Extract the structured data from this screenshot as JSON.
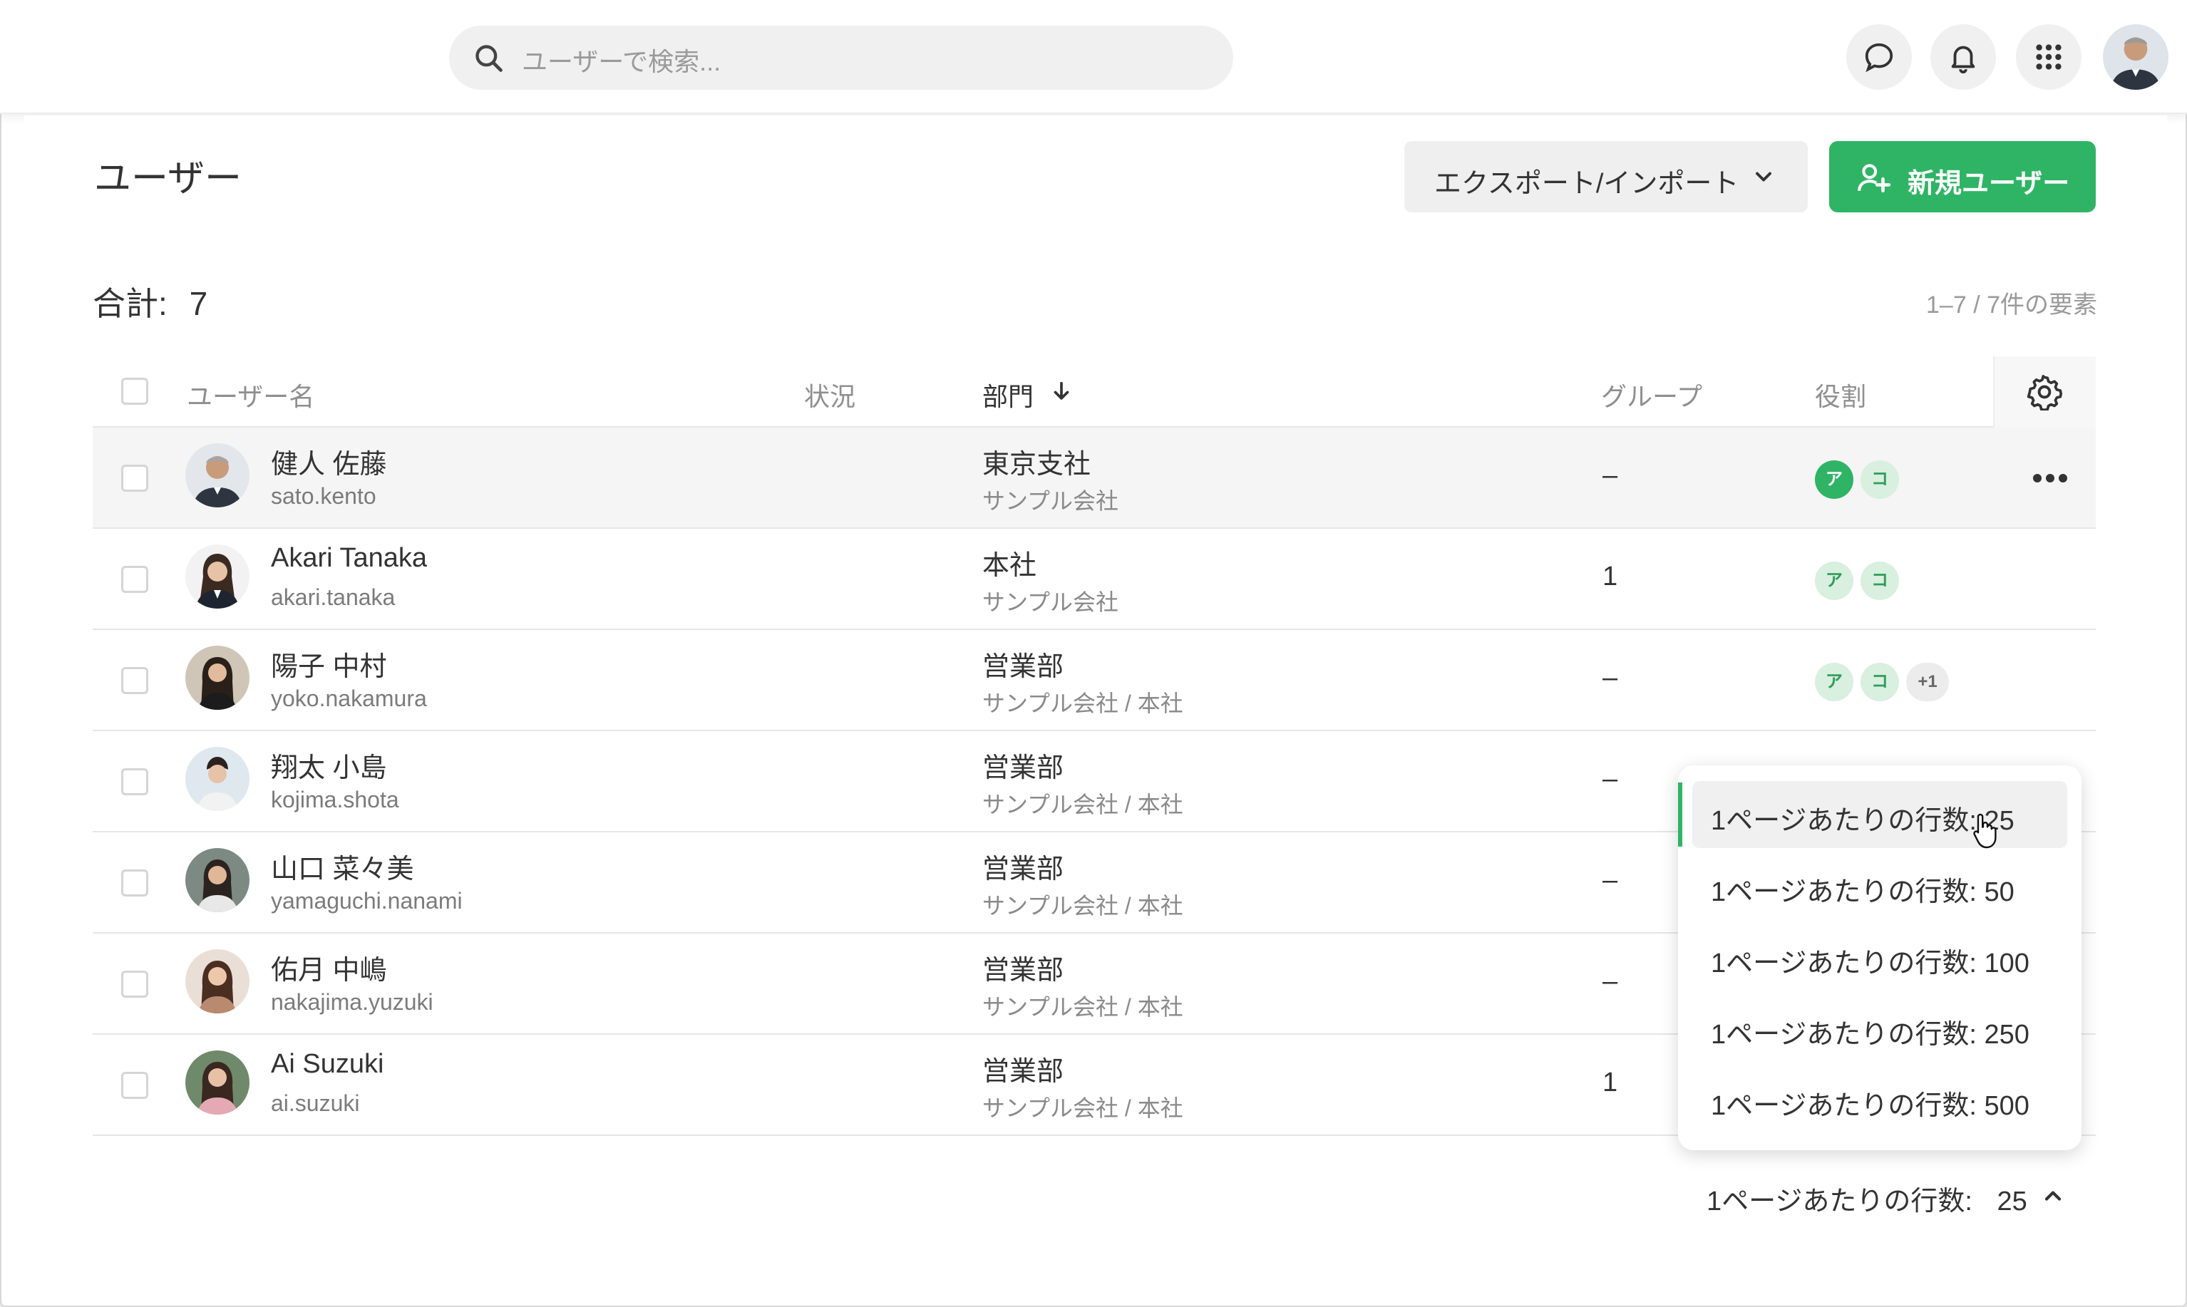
{
  "colors": {
    "accent": "#2fb465",
    "accent_light": "#d9efe0"
  },
  "topbar": {
    "search_placeholder": "ユーザーで検索...",
    "icons": [
      "search-icon",
      "chat-icon",
      "bell-icon",
      "apps-grid-icon",
      "user-avatar"
    ]
  },
  "page": {
    "title": "ユーザー",
    "export_label": "エクスポート/インポート",
    "new_user_label": "新規ユーザー",
    "total_label": "合計:",
    "total_value": "7",
    "range_text": "1–7 / 7件の要素"
  },
  "table": {
    "headers": {
      "name": "ユーザー名",
      "status": "状況",
      "department": "部門",
      "group": "グループ",
      "role": "役割"
    },
    "rows": [
      {
        "name": "健人 佐藤",
        "login": "sato.kento",
        "dept": "東京支社",
        "dept_sub": "サンプル会社",
        "group": "–",
        "roles": [
          "ア",
          "コ"
        ],
        "role_extra": ""
      },
      {
        "name": "Akari Tanaka",
        "login": "akari.tanaka",
        "dept": "本社",
        "dept_sub": "サンプル会社",
        "group": "1",
        "roles": [
          "ア",
          "コ"
        ],
        "role_extra": ""
      },
      {
        "name": "陽子 中村",
        "login": "yoko.nakamura",
        "dept": "営業部",
        "dept_sub": "サンプル会社 / 本社",
        "group": "–",
        "roles": [
          "ア",
          "コ"
        ],
        "role_extra": "+1"
      },
      {
        "name": "翔太 小島",
        "login": "kojima.shota",
        "dept": "営業部",
        "dept_sub": "サンプル会社 / 本社",
        "group": "–",
        "roles": [],
        "role_extra": ""
      },
      {
        "name": "山口 菜々美",
        "login": "yamaguchi.nanami",
        "dept": "営業部",
        "dept_sub": "サンプル会社 / 本社",
        "group": "–",
        "roles": [],
        "role_extra": ""
      },
      {
        "name": "佑月 中嶋",
        "login": "nakajima.yuzuki",
        "dept": "営業部",
        "dept_sub": "サンプル会社 / 本社",
        "group": "–",
        "roles": [],
        "role_extra": ""
      },
      {
        "name": "Ai Suzuki",
        "login": "ai.suzuki",
        "dept": "営業部",
        "dept_sub": "サンプル会社 / 本社",
        "group": "1",
        "roles": [],
        "role_extra": ""
      }
    ]
  },
  "rows_per_page": {
    "footer_label": "1ページあたりの行数:",
    "footer_value": "25",
    "options": [
      "1ページあたりの行数:  25",
      "1ページあたりの行数:  50",
      "1ページあたりの行数:  100",
      "1ページあたりの行数:  250",
      "1ページあたりの行数:  500"
    ],
    "selected_index": 0
  }
}
